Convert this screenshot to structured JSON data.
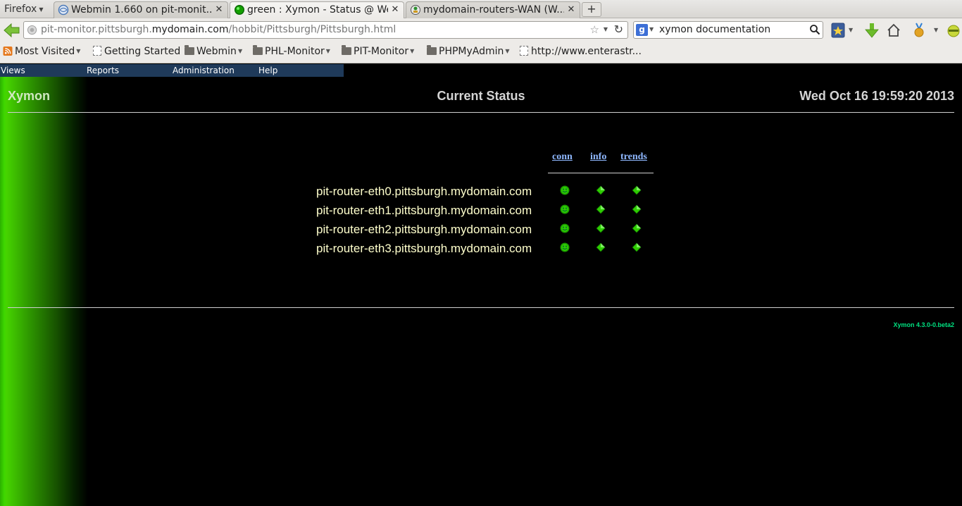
{
  "browser": {
    "app_menu": "Firefox",
    "tabs": [
      {
        "label": "Webmin 1.660 on pit-monit...",
        "icon": "webmin-icon",
        "active": false
      },
      {
        "label": "green : Xymon - Status @ We...",
        "icon": "green-status-icon",
        "active": true
      },
      {
        "label": "mydomain-routers-WAN (W...",
        "icon": "cacti-icon",
        "active": false
      }
    ],
    "new_tab": "+",
    "url": {
      "prefix": "pit-monitor.pittsburgh.",
      "domain": "mydomain.com",
      "path": "/hobbit/Pittsburgh/Pittsburgh.html"
    },
    "search": {
      "engine": "Google",
      "value": "xymon documentation"
    },
    "bookmarks": [
      {
        "label": "Most Visited",
        "icon": "rss-icon",
        "dropdown": true
      },
      {
        "label": "Getting Started",
        "icon": "page-icon",
        "dropdown": false
      },
      {
        "label": "Webmin",
        "icon": "folder-icon",
        "dropdown": true
      },
      {
        "label": "PHL-Monitor",
        "icon": "folder-icon",
        "dropdown": true
      },
      {
        "label": "PIT-Monitor",
        "icon": "folder-icon",
        "dropdown": true
      },
      {
        "label": "PHPMyAdmin",
        "icon": "folder-icon",
        "dropdown": true
      },
      {
        "label": "http://www.enterastr...",
        "icon": "page-icon",
        "dropdown": false
      }
    ]
  },
  "xymon": {
    "menu": [
      "Views",
      "Reports",
      "Administration",
      "Help"
    ],
    "brand": "Xymon",
    "title": "Current Status",
    "datetime": "Wed Oct 16 19:59:20 2013",
    "columns": [
      "conn",
      "info",
      "trends"
    ],
    "hosts": [
      {
        "name": "pit-router-eth0.pittsburgh.mydomain.com",
        "conn": "green",
        "info": "green",
        "trends": "green"
      },
      {
        "name": "pit-router-eth1.pittsburgh.mydomain.com",
        "conn": "green",
        "info": "green",
        "trends": "green"
      },
      {
        "name": "pit-router-eth2.pittsburgh.mydomain.com",
        "conn": "green",
        "info": "green",
        "trends": "green"
      },
      {
        "name": "pit-router-eth3.pittsburgh.mydomain.com",
        "conn": "green",
        "info": "green",
        "trends": "green"
      }
    ],
    "version": "Xymon 4.3.0-0.beta2",
    "colors": {
      "status_green": "#2ecc00",
      "header_text": "#d4d4d4",
      "link": "#8fb8ff",
      "host_text": "#ffffcc",
      "version": "#00e080"
    }
  }
}
